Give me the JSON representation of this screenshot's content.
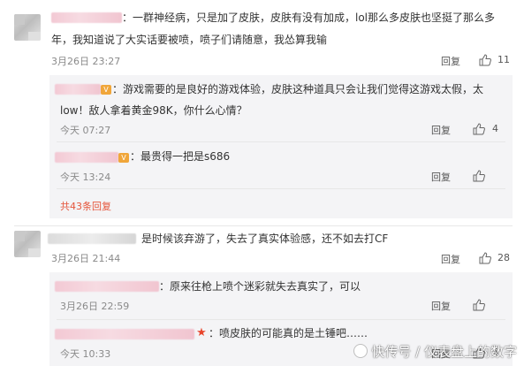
{
  "comments": [
    {
      "text_line1": "：一群神经病，只是加了皮肤，皮肤有没有加成，lol那么多皮肤也坚挺了那么多",
      "text_line2": "年，我知道说了大实话要被喷，喷子们请随意，我怂算我输",
      "time": "3月26日 23:27",
      "reply_label": "回复",
      "likes": "11",
      "replies": [
        {
          "text_line1": "：游戏需要的是良好的游戏体验，皮肤这种道具只会让我们觉得这游戏太假，太",
          "text_line2": "low！敌人拿着黄金98K，你什么心情？",
          "time": "今天 07:27",
          "reply_label": "回复",
          "likes": "4"
        },
        {
          "text_line1": "：最贵得一把是s686",
          "time": "今天 13:24",
          "reply_label": "回复",
          "likes": ""
        }
      ],
      "more_replies": "共43条回复"
    },
    {
      "text_line1": "是时候该弃游了，失去了真实体验感，还不如去打CF",
      "time": "3月26日 21:44",
      "reply_label": "回复",
      "likes": "28",
      "replies": [
        {
          "text_line1": "：原来往枪上喷个迷彩就失去真实了，可以",
          "time": "3月26日 22:59",
          "reply_label": "回复",
          "likes": ""
        },
        {
          "text_line1": "：喷皮肤的可能真的是土锤吧……",
          "time": "今天 10:33",
          "reply_label": "回复",
          "likes": "4"
        }
      ]
    }
  ],
  "watermark": {
    "text": "快传号 / 仪表盘上的数字"
  },
  "colors": {
    "link_red": "#e5553b",
    "vip_orange": "#f0a63a",
    "reply_bg": "#f4f4f6"
  }
}
